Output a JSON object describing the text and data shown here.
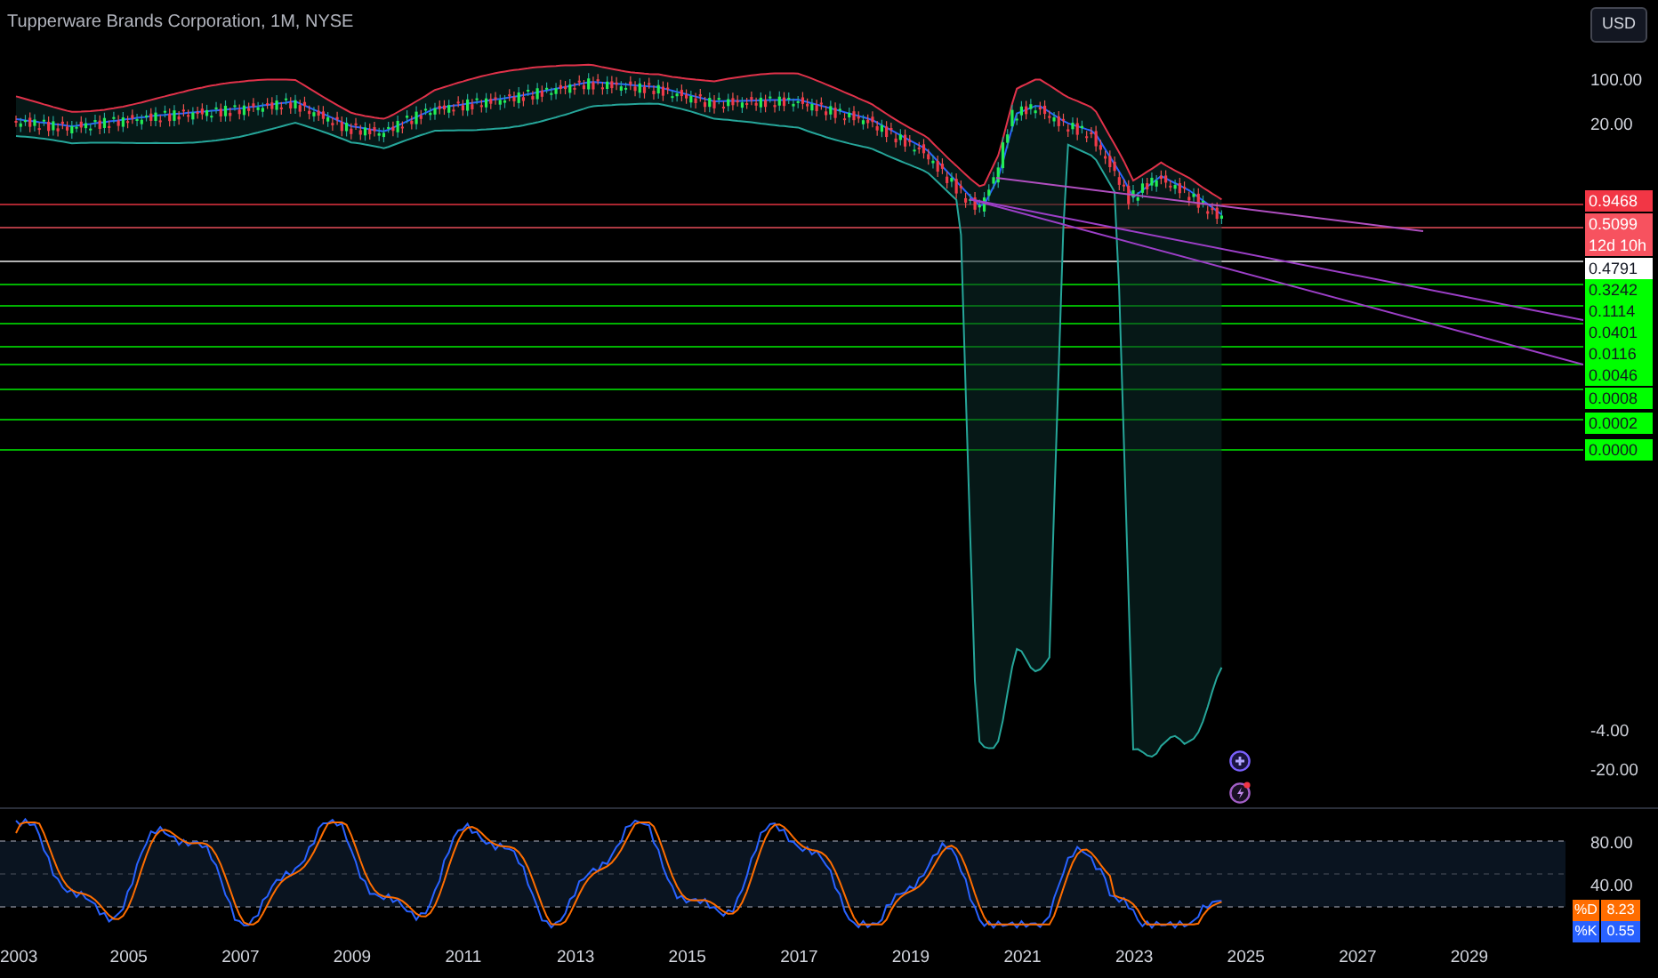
{
  "header": {
    "title": "Tupperware Brands Corporation, 1M, NYSE",
    "currency": "USD"
  },
  "price_axis": {
    "ticks": [
      "100.00",
      "20.00",
      "-4.00",
      "-20.00"
    ]
  },
  "levels": [
    {
      "value": "0.9468",
      "color": "#f23645"
    },
    {
      "value": "0.5099",
      "countdown": "12d 10h",
      "color": "#f7525f"
    },
    {
      "value": "0.4791",
      "color": "#ffffff"
    },
    {
      "value": "0.3242",
      "color": "#00ff00"
    },
    {
      "value": "0.1114",
      "color": "#00ff00"
    },
    {
      "value": "0.0401",
      "color": "#00ff00"
    },
    {
      "value": "0.0116",
      "color": "#00ff00"
    },
    {
      "value": "0.0046",
      "color": "#00ff00"
    },
    {
      "value": "0.0008",
      "color": "#00ff00"
    },
    {
      "value": "0.0002",
      "color": "#00ff00"
    },
    {
      "value": "0.0000",
      "color": "#00ff00"
    }
  ],
  "oscillator": {
    "ticks": [
      "80.00",
      "40.00"
    ],
    "readings": [
      {
        "name": "%D",
        "value": "8.23",
        "color": "#ff6d00"
      },
      {
        "name": "%K",
        "value": "0.55",
        "color": "#2962ff"
      }
    ]
  },
  "time_axis": [
    "2003",
    "2005",
    "2007",
    "2009",
    "2011",
    "2013",
    "2015",
    "2017",
    "2019",
    "2021",
    "2023",
    "2025",
    "2027",
    "2029"
  ]
}
